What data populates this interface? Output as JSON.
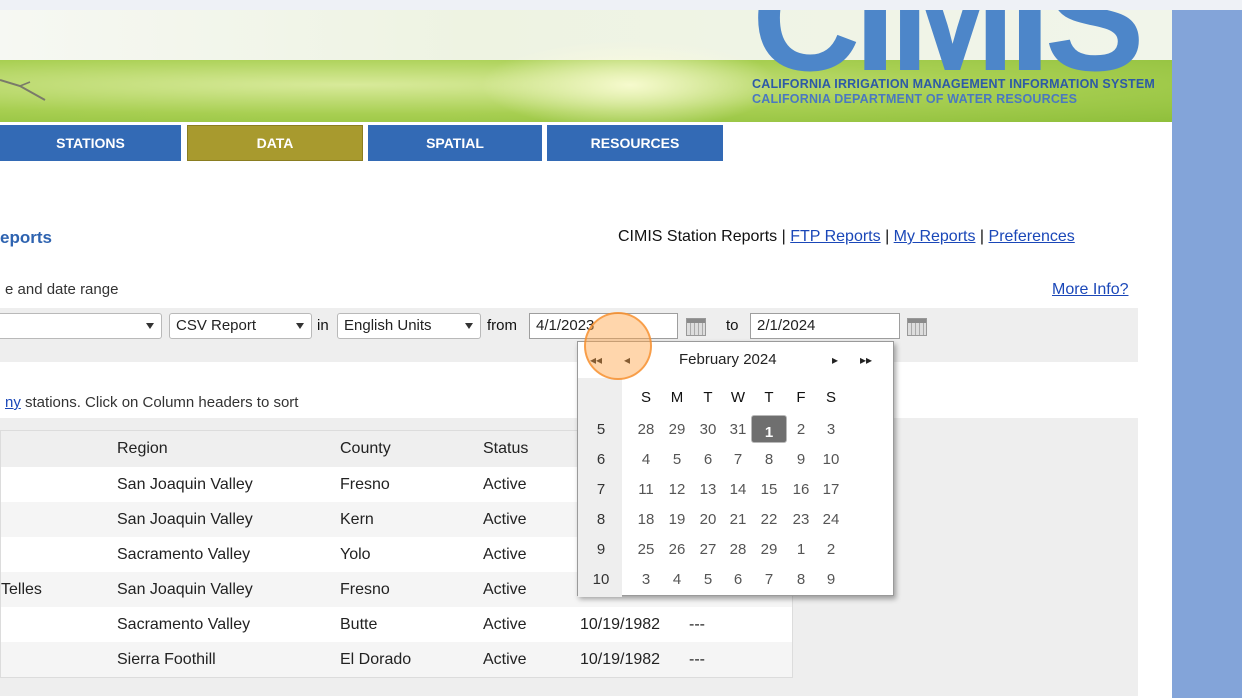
{
  "header": {
    "logo_text": "CIMIS",
    "tagline_line1": "CALIFORNIA IRRIGATION MANAGEMENT INFORMATION SYSTEM",
    "tagline_line2": "CALIFORNIA DEPARTMENT OF WATER RESOURCES"
  },
  "nav": [
    "STATIONS",
    "DATA",
    "SPATIAL",
    "RESOURCES"
  ],
  "page": {
    "title": "eports",
    "links_prefix": "CIMIS Station Reports | ",
    "links": [
      "FTP Reports",
      "My Reports",
      "Preferences"
    ],
    "separator": " | ",
    "subtitle": "e and date range",
    "more_info": "More Info?"
  },
  "filters": {
    "report_type": "CSV Report",
    "in_label": "in",
    "units": "English Units",
    "from_label": "from",
    "from_date": "4/1/2023",
    "to_label": "to",
    "to_date": "2/1/2024"
  },
  "stations_note": {
    "link": "ny",
    "text": " stations. Click on Column headers to sort"
  },
  "table": {
    "headers": [
      "Region",
      "County",
      "Status"
    ],
    "rows": [
      {
        "name": "",
        "region": "San Joaquin Valley",
        "county": "Fresno",
        "status": "Active",
        "date": "",
        "end": ""
      },
      {
        "name": "",
        "region": "San Joaquin Valley",
        "county": "Kern",
        "status": "Active",
        "date": "",
        "end": ""
      },
      {
        "name": "",
        "region": "Sacramento Valley",
        "county": "Yolo",
        "status": "Active",
        "date": "",
        "end": ""
      },
      {
        "name": "Telles",
        "region": "San Joaquin Valley",
        "county": "Fresno",
        "status": "Active",
        "date": "",
        "end": ""
      },
      {
        "name": "",
        "region": "Sacramento Valley",
        "county": "Butte",
        "status": "Active",
        "date": "10/19/1982",
        "end": "---"
      },
      {
        "name": "",
        "region": "Sierra Foothill",
        "county": "El Dorado",
        "status": "Active",
        "date": "10/19/1982",
        "end": "---"
      }
    ]
  },
  "calendar": {
    "month_label": "February 2024",
    "prev_year": "◂◂",
    "prev_month": "◂",
    "next_month": "▸",
    "next_year": "▸▸",
    "dow": [
      "S",
      "M",
      "T",
      "W",
      "T",
      "F",
      "S"
    ],
    "weeks": [
      {
        "wk": "5",
        "days": [
          "28",
          "29",
          "30",
          "31",
          "1",
          "2",
          "3"
        ]
      },
      {
        "wk": "6",
        "days": [
          "4",
          "5",
          "6",
          "7",
          "8",
          "9",
          "10"
        ]
      },
      {
        "wk": "7",
        "days": [
          "11",
          "12",
          "13",
          "14",
          "15",
          "16",
          "17"
        ]
      },
      {
        "wk": "8",
        "days": [
          "18",
          "19",
          "20",
          "21",
          "22",
          "23",
          "24"
        ]
      },
      {
        "wk": "9",
        "days": [
          "25",
          "26",
          "27",
          "28",
          "29",
          "1",
          "2"
        ]
      },
      {
        "wk": "10",
        "days": [
          "3",
          "4",
          "5",
          "6",
          "7",
          "8",
          "9"
        ]
      }
    ],
    "selected_day": "1"
  },
  "colors": {
    "nav_blue": "#336ab5",
    "nav_active": "#a89a2e",
    "link_blue": "#1a47b8",
    "side_bar": "#83a4d9",
    "highlight": "#f5a146"
  }
}
